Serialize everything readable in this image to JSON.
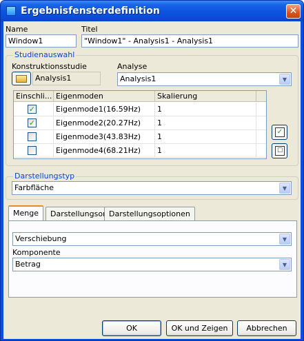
{
  "window": {
    "title": "Ergebnisfensterdefinition"
  },
  "name": {
    "label": "Name",
    "value": "Window1"
  },
  "titel": {
    "label": "Titel",
    "value": "\"Window1\" - Analysis1 - Analysis1"
  },
  "studienauswahl": {
    "group_title": "Studienauswahl",
    "konstruktionsstudie_label": "Konstruktionsstudie",
    "konstruktionsstudie_value": "Analysis1",
    "analyse_label": "Analyse",
    "analyse_value": "Analysis1"
  },
  "eigenmodes": {
    "headers": [
      "Einschli...",
      "Eigenmoden",
      "Skalierung"
    ],
    "rows": [
      {
        "checked": true,
        "name": "Eigenmode1(16.59Hz)",
        "scale": "1"
      },
      {
        "checked": true,
        "name": "Eigenmode2(20.27Hz)",
        "scale": "1"
      },
      {
        "checked": false,
        "name": "Eigenmode3(43.83Hz)",
        "scale": "1"
      },
      {
        "checked": false,
        "name": "Eigenmode4(68.21Hz)",
        "scale": "1"
      }
    ]
  },
  "darstellungstyp": {
    "group_title": "Darstellungstyp",
    "value": "Farbfläche"
  },
  "tabs": [
    "Menge",
    "Darstellungsort",
    "Darstellungsoptionen"
  ],
  "menge": {
    "quantity_value": "Verschiebung",
    "komponente_label": "Komponente",
    "komponente_value": "Betrag"
  },
  "buttons": {
    "ok": "OK",
    "ok_show": "OK und Zeigen",
    "cancel": "Abbrechen"
  },
  "colors": {
    "titlebar": "#0a4de0",
    "client": "#ece9d8",
    "group_title": "#0046d5",
    "check": "#21a121"
  }
}
